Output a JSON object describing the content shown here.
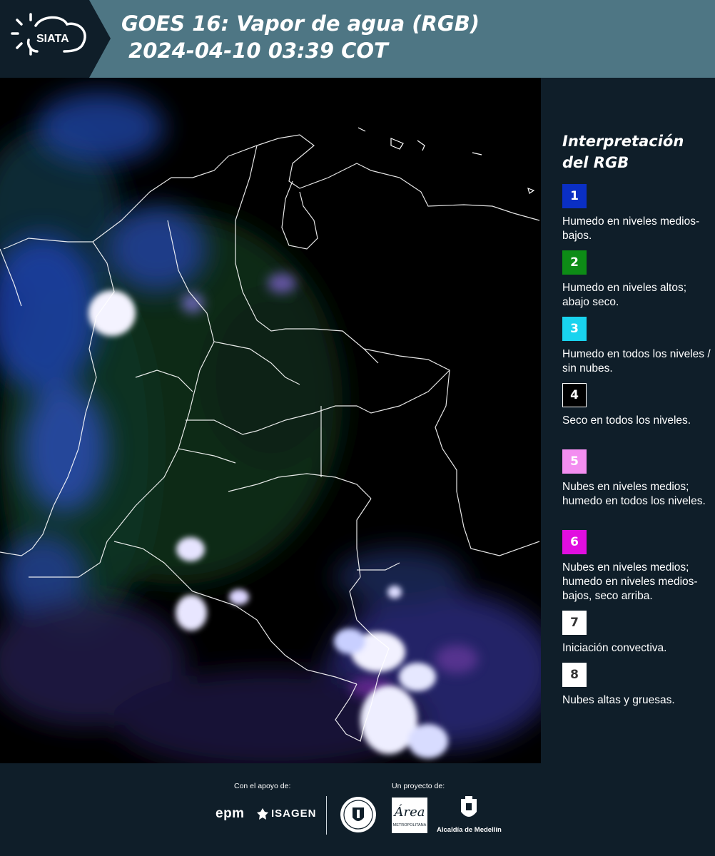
{
  "header": {
    "logo_text": "SIATA",
    "title_line1": "GOES 16: Vapor de agua (RGB)",
    "title_line2": " 2024-04-10 03:39 COT"
  },
  "legend": {
    "title": "Interpretación del RGB",
    "items": [
      {
        "number": "1",
        "color": "#0a2fc4",
        "text": "Humedo en niveles medios-bajos."
      },
      {
        "number": "2",
        "color": "#0d8c16",
        "text": "Humedo en niveles altos; abajo seco."
      },
      {
        "number": "3",
        "color": "#19d3ee",
        "text": "Humedo en todos los niveles / sin nubes."
      },
      {
        "number": "4",
        "color": "#000000",
        "text": "Seco en todos los niveles."
      },
      {
        "number": "5",
        "color": "#f38ef0",
        "text": "Nubes en niveles medios; humedo en todos los niveles."
      },
      {
        "number": "6",
        "color": "#e10ee0",
        "text": "Nubes en niveles medios; humedo en niveles medios-bajos, seco arriba."
      },
      {
        "number": "7",
        "color": "#ffffff",
        "text": "Iniciación convectiva."
      },
      {
        "number": "8",
        "color": "#ffffff",
        "text": "Nubes altas y gruesas."
      }
    ]
  },
  "footer": {
    "support_label": "Con el apoyo de:",
    "project_label": "Un proyecto de:",
    "sponsor_epm": "epm",
    "sponsor_isagen": "ISAGEN",
    "area_logo_text": "Área",
    "area_logo_subtext": "METROPOLITANA",
    "alcaldia_text": "Alcaldía de Medellín"
  }
}
